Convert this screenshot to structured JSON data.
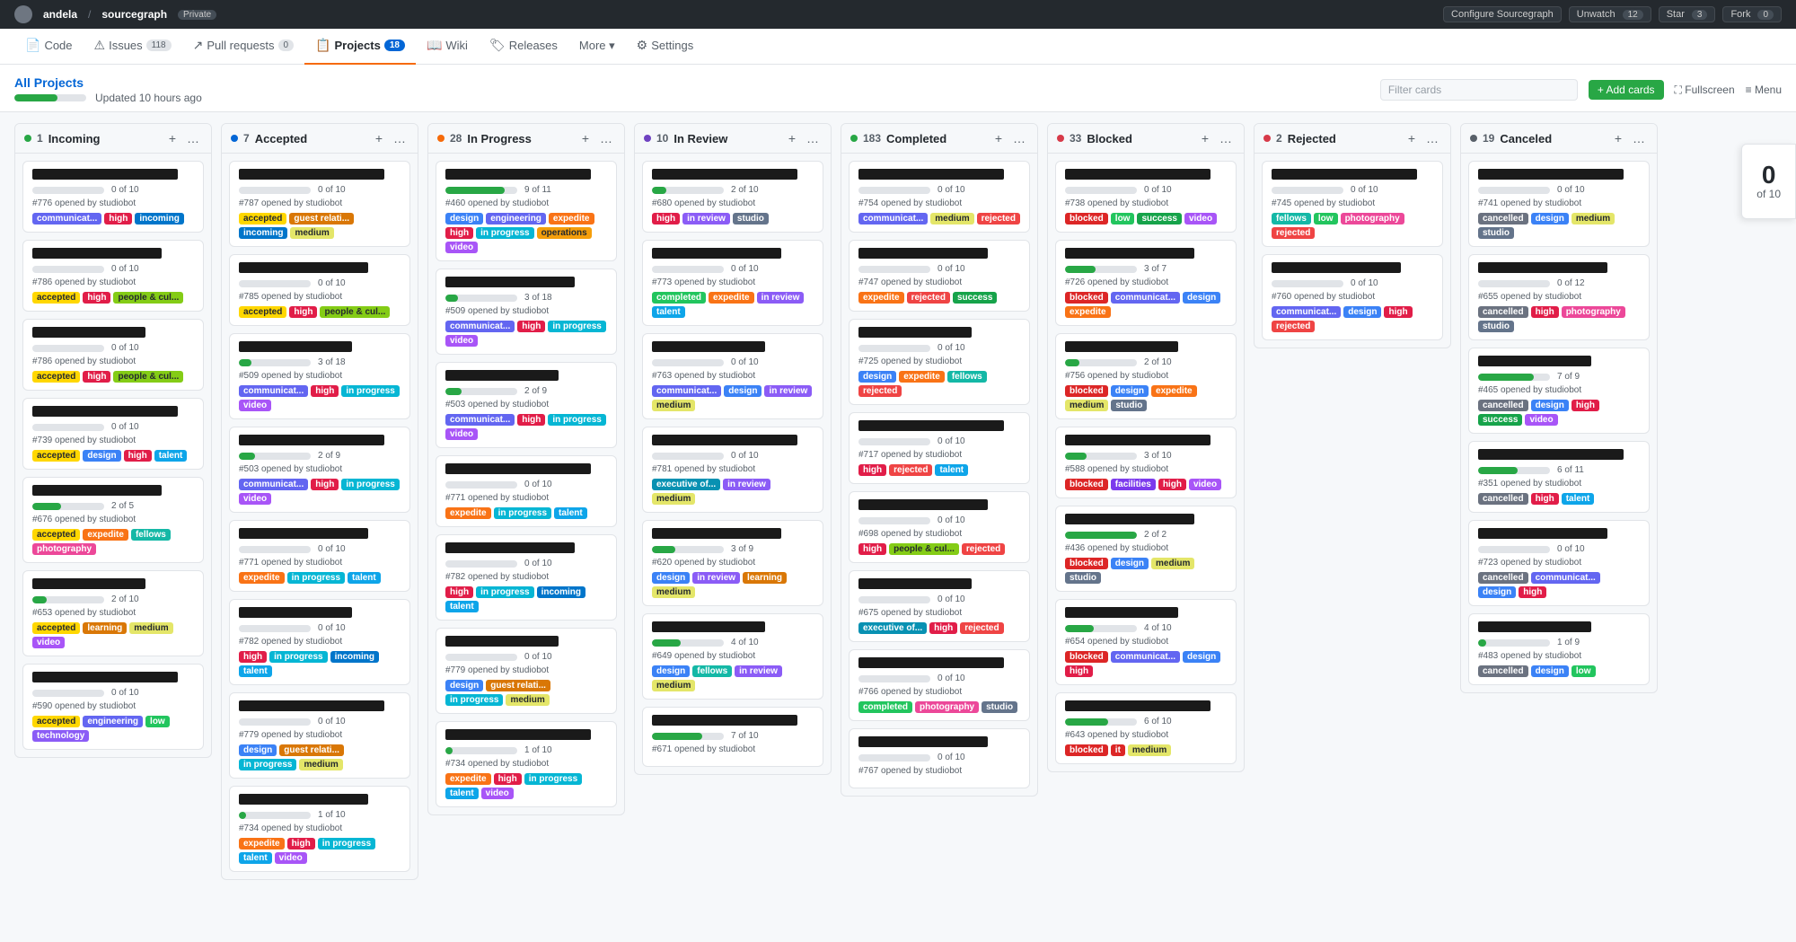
{
  "topbar": {
    "user": "andela",
    "repo": "sourcegraph",
    "private_label": "Private",
    "configure_label": "Configure Sourcegraph",
    "unwatch_label": "Unwatch",
    "unwatch_count": "12",
    "star_label": "Star",
    "star_count": "3",
    "fork_label": "Fork",
    "fork_count": "0"
  },
  "nav": {
    "items": [
      {
        "id": "code",
        "label": "Code",
        "icon": "📄",
        "badge": ""
      },
      {
        "id": "issues",
        "label": "Issues",
        "icon": "⚠",
        "badge": "118"
      },
      {
        "id": "pull-requests",
        "label": "Pull requests",
        "icon": "↗",
        "badge": "0"
      },
      {
        "id": "projects",
        "label": "Projects",
        "icon": "📋",
        "badge": "18",
        "active": true
      },
      {
        "id": "wiki",
        "label": "Wiki",
        "icon": "📖",
        "badge": ""
      },
      {
        "id": "releases",
        "label": "Releases",
        "icon": "🏷",
        "badge": ""
      },
      {
        "id": "more",
        "label": "More",
        "icon": "",
        "badge": ""
      },
      {
        "id": "settings",
        "label": "Settings",
        "icon": "⚙",
        "badge": ""
      }
    ]
  },
  "header": {
    "title": "All Projects",
    "subtitle": "Updated 10 hours ago",
    "filter_placeholder": "Filter cards",
    "add_cards": "+ Add cards",
    "fullscreen": "⛶ Fullscreen",
    "menu": "≡ Menu"
  },
  "progress_counter": {
    "current": "0",
    "total": "10",
    "label": "of 10"
  },
  "columns": [
    {
      "id": "incoming",
      "num": "1",
      "title": "Incoming",
      "status": "green",
      "cards": [
        {
          "progress": "0 of 10",
          "issue": "#776 opened by studiobot",
          "tags": [
            "communicat...",
            "high",
            "incoming"
          ]
        },
        {
          "progress": "0 of 10",
          "issue": "#786 opened by studiobot",
          "tags": [
            "accepted",
            "high",
            "people & cul..."
          ]
        },
        {
          "progress": "0 of 10",
          "issue": "#786 opened by studiobot",
          "tags": [
            "accepted",
            "high",
            "people & cul..."
          ]
        },
        {
          "progress": "0 of 10",
          "issue": "#739 opened by studiobot",
          "tags": [
            "accepted",
            "design",
            "high",
            "talent"
          ]
        },
        {
          "progress": "2 of 5",
          "issue": "#676 opened by studiobot",
          "tags": [
            "accepted",
            "expedite",
            "fellows",
            "photography"
          ]
        },
        {
          "progress": "2 of 10",
          "issue": "#653 opened by studiobot",
          "tags": [
            "accepted",
            "learning",
            "medium",
            "video"
          ]
        },
        {
          "progress": "0 of 10",
          "issue": "#590 opened by studiobot",
          "tags": [
            "accepted",
            "engineering",
            "low",
            "technology"
          ]
        }
      ]
    },
    {
      "id": "accepted",
      "num": "7",
      "title": "Accepted",
      "status": "blue",
      "cards": [
        {
          "progress": "0 of 10",
          "issue": "#787 opened by studiobot",
          "tags": [
            "accepted",
            "guest relati...",
            "incoming",
            "medium"
          ]
        },
        {
          "progress": "0 of 10",
          "issue": "#785 opened by studiobot",
          "tags": [
            "accepted",
            "high",
            "people & cul..."
          ]
        },
        {
          "progress": "3 of 18",
          "issue": "#509 opened by studiobot",
          "tags": [
            "communicat...",
            "high",
            "in progress",
            "video"
          ]
        },
        {
          "progress": "2 of 9",
          "issue": "#503 opened by studiobot",
          "tags": [
            "communicat...",
            "high",
            "in progress",
            "video"
          ]
        },
        {
          "progress": "0 of 10",
          "issue": "#771 opened by studiobot",
          "tags": [
            "expedite",
            "in progress",
            "talent"
          ]
        },
        {
          "progress": "0 of 10",
          "issue": "#782 opened by studiobot",
          "tags": [
            "high",
            "in progress",
            "incoming",
            "talent"
          ]
        },
        {
          "progress": "0 of 10",
          "issue": "#779 opened by studiobot",
          "tags": [
            "design",
            "guest relati...",
            "in progress",
            "medium"
          ]
        },
        {
          "progress": "1 of 10",
          "issue": "#734 opened by studiobot",
          "tags": [
            "expedite",
            "high",
            "in progress",
            "talent",
            "video"
          ]
        }
      ]
    },
    {
      "id": "in-progress",
      "num": "28",
      "title": "In Progress",
      "status": "orange",
      "cards": [
        {
          "progress": "9 of 11",
          "issue": "#460 opened by studiobot",
          "tags": [
            "design",
            "engineering",
            "expedite",
            "high",
            "in progress",
            "operations",
            "video"
          ]
        },
        {
          "progress": "3 of 18",
          "issue": "#509 opened by studiobot",
          "tags": [
            "communicat...",
            "high",
            "in progress",
            "video"
          ]
        },
        {
          "progress": "2 of 9",
          "issue": "#503 opened by studiobot",
          "tags": [
            "communicat...",
            "high",
            "in progress",
            "video"
          ]
        },
        {
          "progress": "0 of 10",
          "issue": "#771 opened by studiobot",
          "tags": [
            "expedite",
            "in progress",
            "talent"
          ]
        },
        {
          "progress": "0 of 10",
          "issue": "#782 opened by studiobot",
          "tags": [
            "high",
            "in progress",
            "incoming",
            "talent"
          ]
        },
        {
          "progress": "0 of 10",
          "issue": "#779 opened by studiobot",
          "tags": [
            "design",
            "guest relati...",
            "in progress",
            "medium"
          ]
        },
        {
          "progress": "1 of 10",
          "issue": "#734 opened by studiobot",
          "tags": [
            "expedite",
            "high",
            "in progress",
            "talent",
            "video"
          ]
        }
      ]
    },
    {
      "id": "in-review",
      "num": "10",
      "title": "In Review",
      "status": "purple",
      "cards": [
        {
          "progress": "2 of 10",
          "issue": "#680 opened by studiobot",
          "tags": [
            "high",
            "in review",
            "studio"
          ]
        },
        {
          "progress": "0 of 10",
          "issue": "#773 opened by studiobot",
          "tags": [
            "completed",
            "expedite",
            "in review",
            "talent"
          ]
        },
        {
          "progress": "0 of 10",
          "issue": "#763 opened by studiobot",
          "tags": [
            "communicat...",
            "design",
            "in review",
            "medium"
          ]
        },
        {
          "progress": "0 of 10",
          "issue": "#781 opened by studiobot",
          "tags": [
            "executive of...",
            "in review",
            "medium"
          ]
        },
        {
          "progress": "3 of 9",
          "issue": "#620 opened by studiobot",
          "tags": [
            "design",
            "in review",
            "learning",
            "medium"
          ]
        },
        {
          "progress": "4 of 10",
          "issue": "#649 opened by studiobot",
          "tags": [
            "design",
            "fellows",
            "in review",
            "medium"
          ]
        },
        {
          "progress": "7 of 10",
          "issue": "#671 opened by studiobot",
          "tags": []
        }
      ]
    },
    {
      "id": "completed",
      "num": "183",
      "title": "Completed",
      "status": "green",
      "cards": [
        {
          "progress": "0 of 10",
          "issue": "#754 opened by studiobot",
          "tags": [
            "communicat...",
            "medium",
            "rejected"
          ]
        },
        {
          "progress": "0 of 10",
          "issue": "#747 opened by studiobot",
          "tags": [
            "expedite",
            "rejected",
            "success"
          ]
        },
        {
          "progress": "0 of 10",
          "issue": "#725 opened by studiobot",
          "tags": [
            "design",
            "expedite",
            "fellows",
            "rejected"
          ]
        },
        {
          "progress": "0 of 10",
          "issue": "#717 opened by studiobot",
          "tags": [
            "high",
            "rejected",
            "talent"
          ]
        },
        {
          "progress": "0 of 10",
          "issue": "#698 opened by studiobot",
          "tags": [
            "high",
            "people & cul...",
            "rejected"
          ]
        },
        {
          "progress": "0 of 10",
          "issue": "#675 opened by studiobot",
          "tags": [
            "executive of...",
            "high",
            "rejected"
          ]
        },
        {
          "progress": "0 of 10",
          "issue": "#766 opened by studiobot",
          "tags": [
            "completed",
            "photography",
            "studio"
          ]
        },
        {
          "progress": "0 of 10",
          "issue": "#767 opened by studiobot",
          "tags": []
        }
      ]
    },
    {
      "id": "blocked",
      "num": "33",
      "title": "Blocked",
      "status": "red",
      "cards": [
        {
          "progress": "0 of 10",
          "issue": "#738 opened by studiobot",
          "tags": [
            "blocked",
            "low",
            "success",
            "video"
          ]
        },
        {
          "progress": "3 of 7",
          "issue": "#726 opened by studiobot",
          "tags": [
            "blocked",
            "communicat...",
            "design",
            "expedite"
          ]
        },
        {
          "progress": "2 of 10",
          "issue": "#756 opened by studiobot",
          "tags": [
            "blocked",
            "design",
            "expedite",
            "medium",
            "studio"
          ]
        },
        {
          "progress": "3 of 10",
          "issue": "#588 opened by studiobot",
          "tags": [
            "blocked",
            "facilities",
            "high",
            "video"
          ]
        },
        {
          "progress": "2 of 2",
          "issue": "#436 opened by studiobot",
          "tags": [
            "blocked",
            "design",
            "medium",
            "studio"
          ]
        },
        {
          "progress": "4 of 10",
          "issue": "#654 opened by studiobot",
          "tags": [
            "blocked",
            "communicat...",
            "design",
            "high"
          ]
        },
        {
          "progress": "6 of 10",
          "issue": "#643 opened by studiobot",
          "tags": [
            "blocked",
            "it",
            "medium"
          ]
        }
      ]
    },
    {
      "id": "rejected",
      "num": "2",
      "title": "Rejected",
      "status": "red",
      "cards": [
        {
          "progress": "0 of 10",
          "issue": "#745 opened by studiobot",
          "tags": [
            "fellows",
            "low",
            "photography",
            "rejected"
          ]
        },
        {
          "progress": "0 of 10",
          "issue": "#760 opened by studiobot",
          "tags": [
            "communicat...",
            "design",
            "high",
            "rejected"
          ]
        }
      ]
    },
    {
      "id": "cancelled",
      "num": "19",
      "title": "Canceled",
      "status": "gray",
      "cards": [
        {
          "progress": "0 of 10",
          "issue": "#741 opened by studiobot",
          "tags": [
            "cancelled",
            "design",
            "medium",
            "studio"
          ]
        },
        {
          "progress": "0 of 12",
          "issue": "#655 opened by studiobot",
          "tags": [
            "cancelled",
            "high",
            "photography",
            "studio"
          ]
        },
        {
          "progress": "7 of 9",
          "issue": "#465 opened by studiobot",
          "tags": [
            "cancelled",
            "design",
            "high",
            "success",
            "video"
          ]
        },
        {
          "progress": "6 of 11",
          "issue": "#351 opened by studiobot",
          "tags": [
            "cancelled",
            "high",
            "talent"
          ]
        },
        {
          "progress": "0 of 10",
          "issue": "#723 opened by studiobot",
          "tags": [
            "cancelled",
            "communicat...",
            "design",
            "high"
          ]
        },
        {
          "progress": "1 of 9",
          "issue": "#483 opened by studiobot",
          "tags": [
            "cancelled",
            "design",
            "low"
          ]
        }
      ]
    }
  ]
}
